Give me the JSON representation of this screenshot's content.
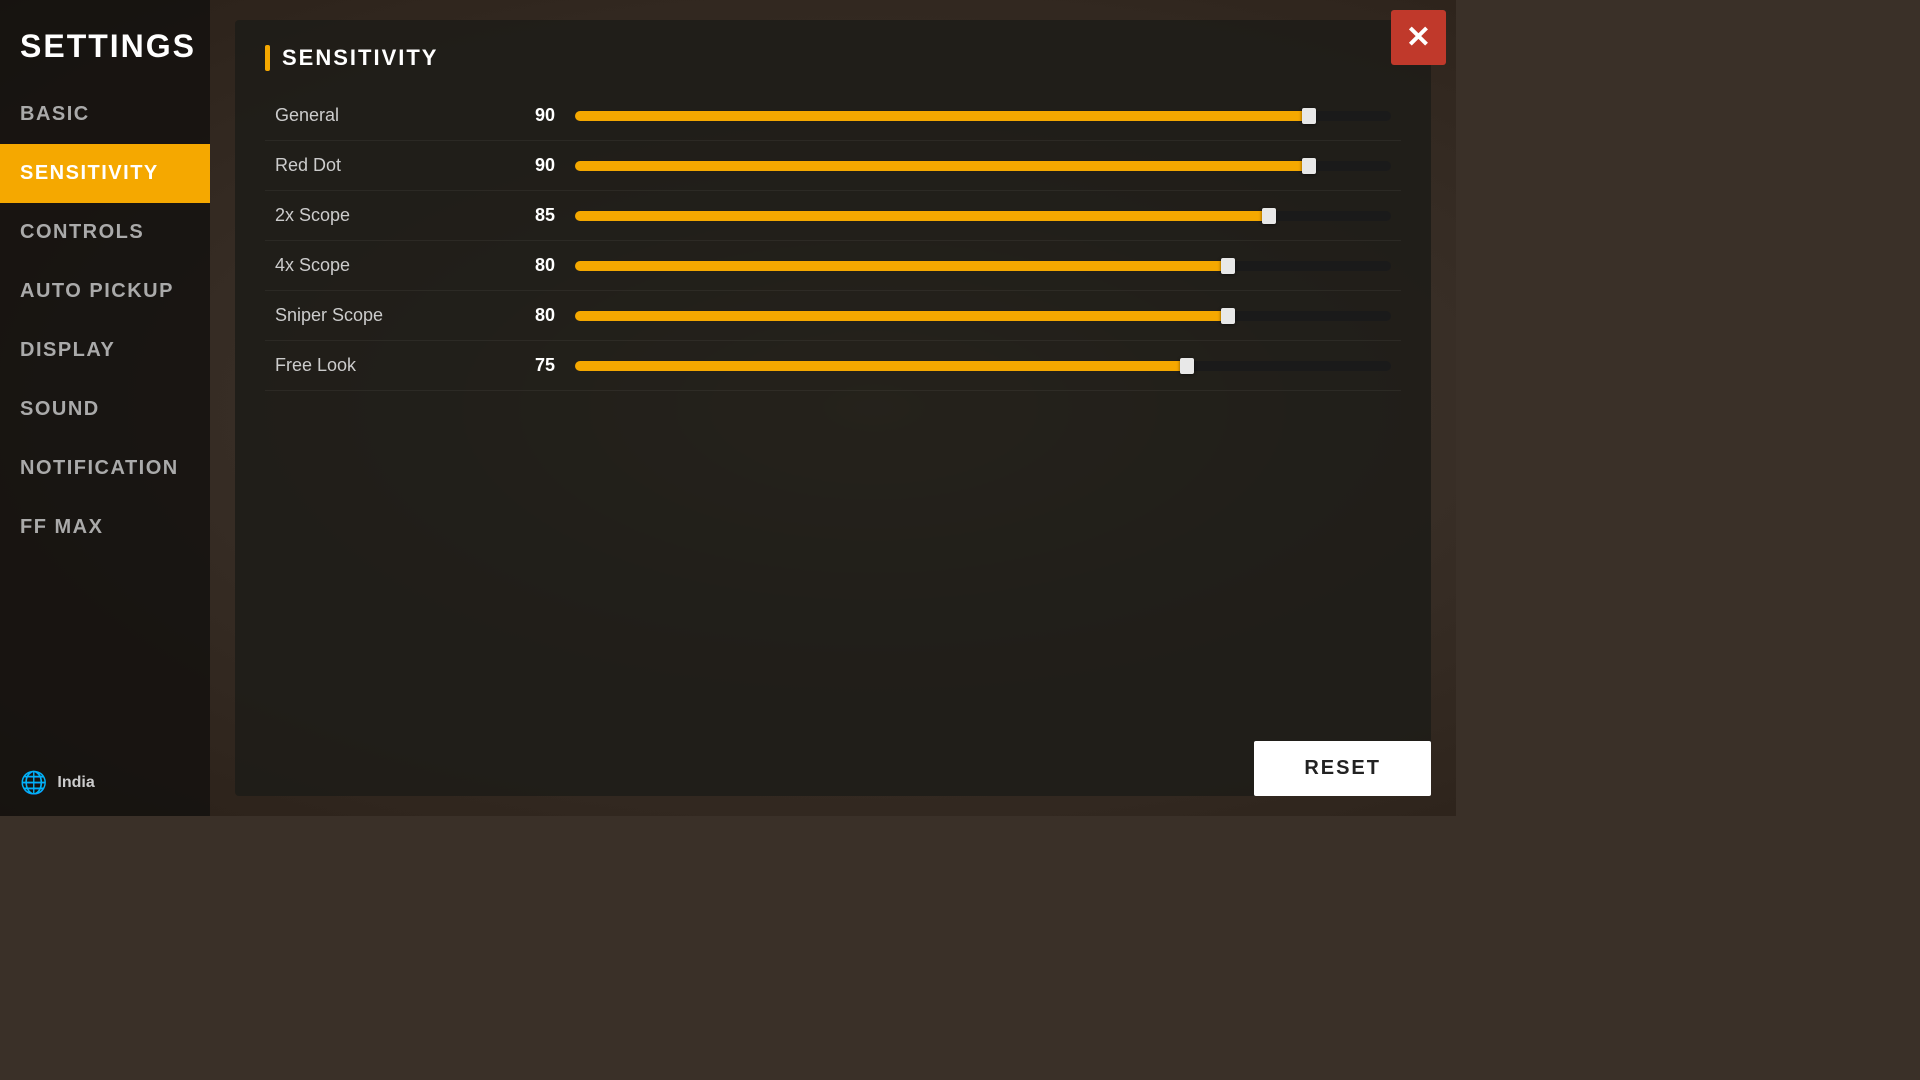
{
  "app": {
    "title": "SETTINGS"
  },
  "sidebar": {
    "items": [
      {
        "id": "basic",
        "label": "BASIC",
        "active": false
      },
      {
        "id": "sensitivity",
        "label": "SENSITIVITY",
        "active": true
      },
      {
        "id": "controls",
        "label": "CONTROLS",
        "active": false
      },
      {
        "id": "auto-pickup",
        "label": "AUTO PICKUP",
        "active": false
      },
      {
        "id": "display",
        "label": "DISPLAY",
        "active": false
      },
      {
        "id": "sound",
        "label": "SOUND",
        "active": false
      },
      {
        "id": "notification",
        "label": "NOTIFICATION",
        "active": false
      },
      {
        "id": "ff-max",
        "label": "FF MAX",
        "active": false
      }
    ],
    "region": {
      "icon": "🌐",
      "label": "India"
    }
  },
  "main": {
    "section_title": "SENSITIVITY",
    "sliders": [
      {
        "label": "General",
        "value": 90,
        "percent": 90
      },
      {
        "label": "Red Dot",
        "value": 90,
        "percent": 90
      },
      {
        "label": "2x Scope",
        "value": 85,
        "percent": 85
      },
      {
        "label": "4x Scope",
        "value": 80,
        "percent": 80
      },
      {
        "label": "Sniper Scope",
        "value": 80,
        "percent": 80
      },
      {
        "label": "Free Look",
        "value": 75,
        "percent": 75
      }
    ],
    "reset_label": "RESET"
  }
}
